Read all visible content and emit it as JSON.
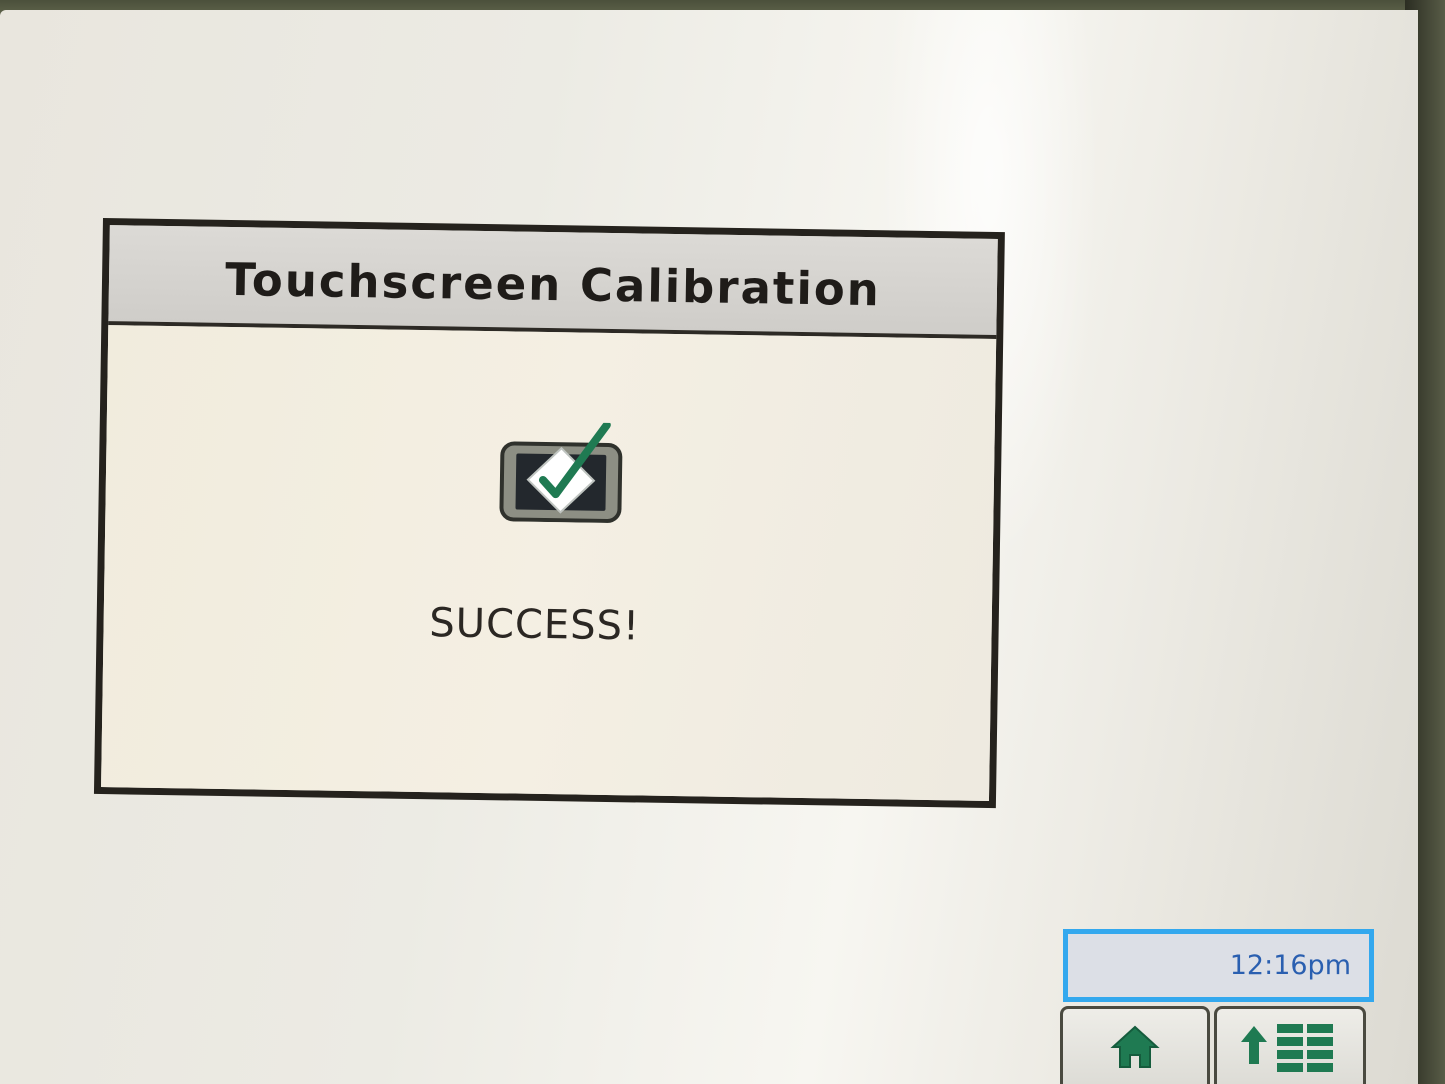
{
  "dialog": {
    "title": "Touchscreen Calibration",
    "icon": "touchscreen-check-icon",
    "status": "SUCCESS!"
  },
  "status_bar": {
    "time": "12:16pm"
  },
  "nav": {
    "home_icon": "home-icon",
    "menu_icon": "up-arrow-grid-icon"
  },
  "colors": {
    "accent_green": "#1f7a52",
    "clock_border": "#33a8ee",
    "clock_text": "#2a5fb0",
    "dialog_border": "#25221d"
  }
}
